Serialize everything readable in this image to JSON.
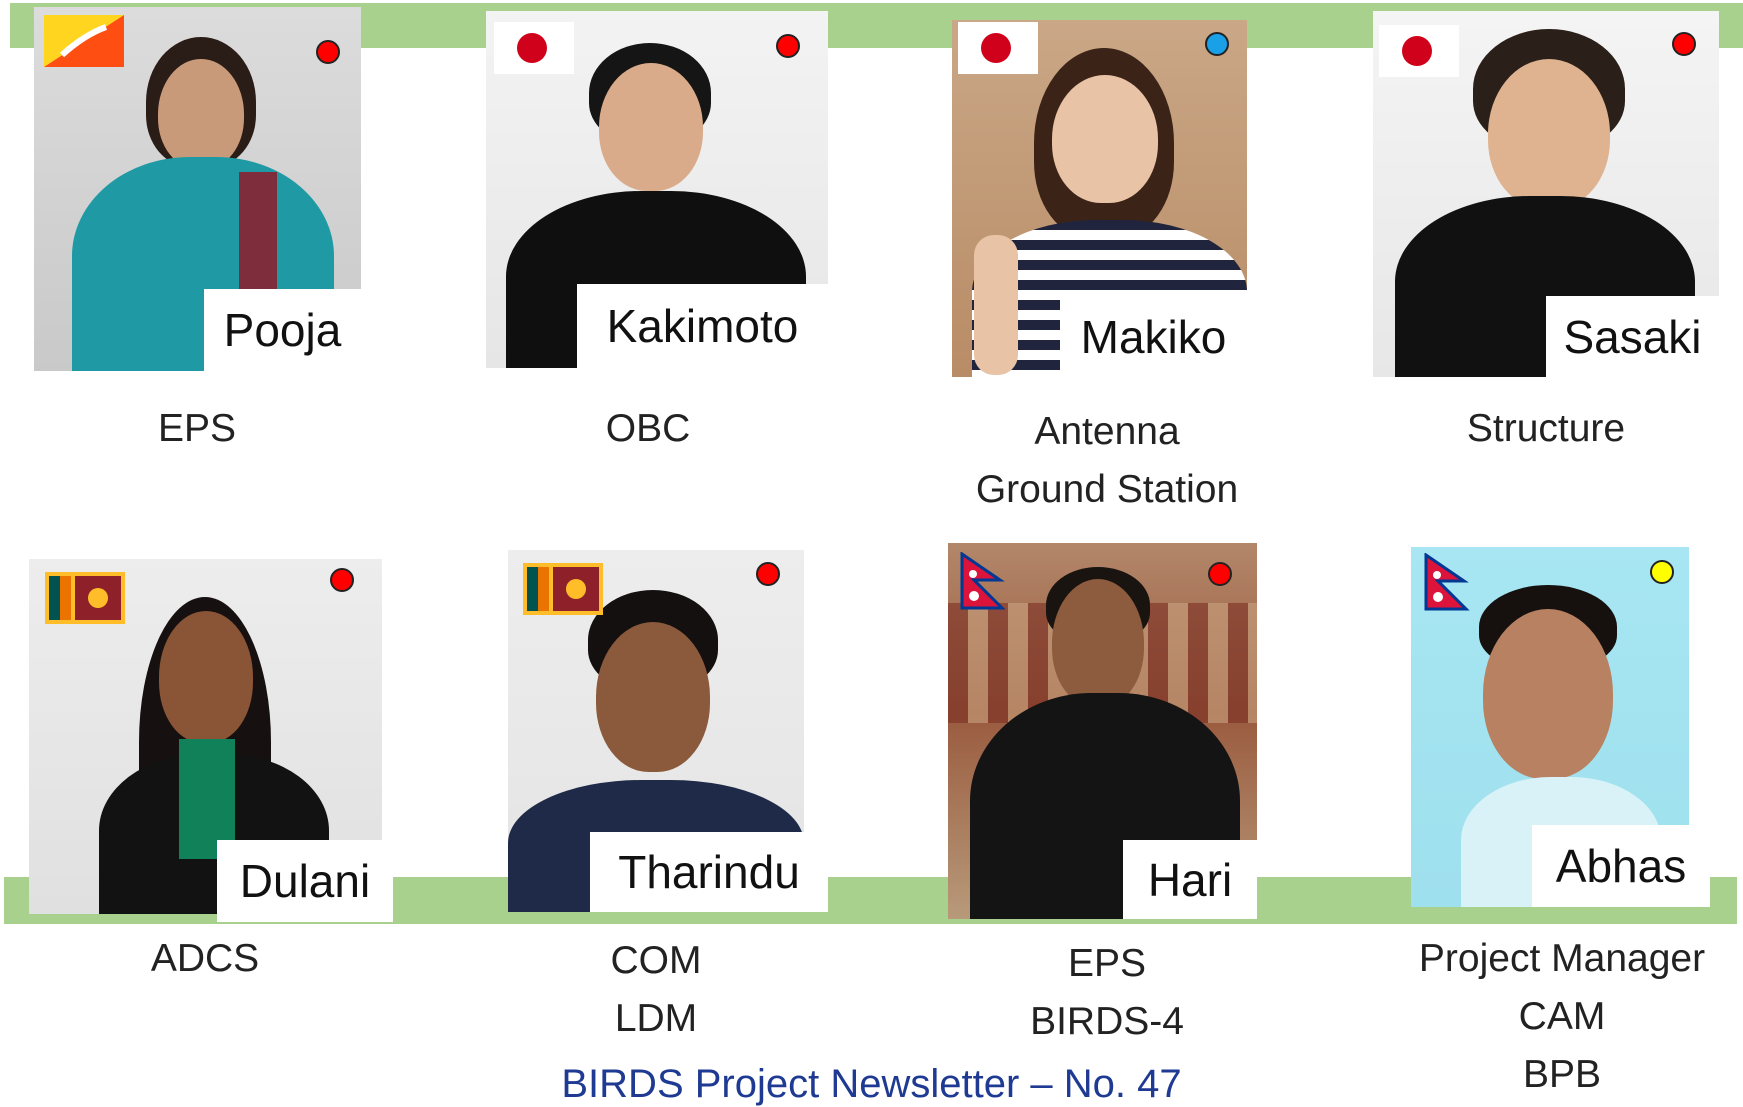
{
  "colors": {
    "band": "#a9d18e",
    "dot_red": "#ff0000",
    "dot_blue": "#19a0e6",
    "dot_yellow": "#ffff00",
    "footer_text": "#1f3a93"
  },
  "members": [
    {
      "name": "Pooja",
      "roles": [
        "EPS"
      ],
      "flag": "bhutan-flag-icon",
      "status_dot": "red"
    },
    {
      "name": "Kakimoto",
      "roles": [
        "OBC"
      ],
      "flag": "japan-flag-icon",
      "status_dot": "red"
    },
    {
      "name": "Makiko",
      "roles": [
        "Antenna",
        "Ground Station"
      ],
      "flag": "japan-flag-icon",
      "status_dot": "blue"
    },
    {
      "name": "Sasaki",
      "roles": [
        "Structure"
      ],
      "flag": "japan-flag-icon",
      "status_dot": "red"
    },
    {
      "name": "Dulani",
      "roles": [
        "ADCS"
      ],
      "flag": "sri-lanka-flag-icon",
      "status_dot": "red"
    },
    {
      "name": "Tharindu",
      "roles": [
        "COM",
        "LDM"
      ],
      "flag": "sri-lanka-flag-icon",
      "status_dot": "red"
    },
    {
      "name": "Hari",
      "roles": [
        "EPS",
        "BIRDS-4"
      ],
      "flag": "nepal-flag-icon",
      "status_dot": "red"
    },
    {
      "name": "Abhas",
      "roles": [
        "Project Manager",
        "CAM",
        "BPB"
      ],
      "flag": "nepal-flag-icon",
      "status_dot": "yellow"
    }
  ],
  "footer": "BIRDS Project Newsletter – No. 47"
}
